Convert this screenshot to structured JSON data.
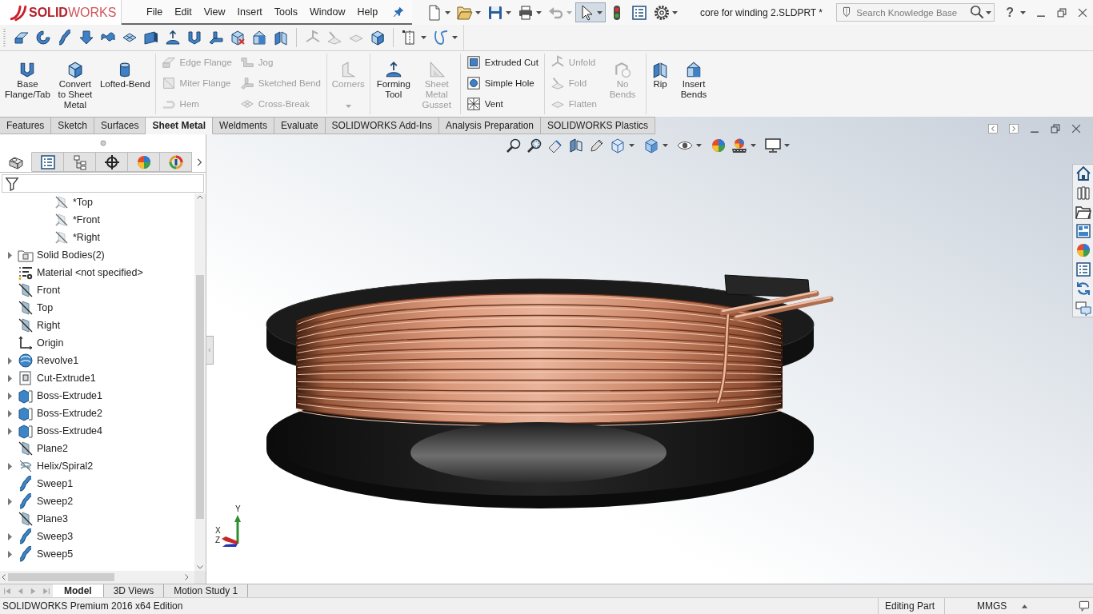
{
  "title_bar": {
    "logo": "**SOLID**WORKS",
    "menu": [
      "File",
      "Edit",
      "View",
      "Insert",
      "Tools",
      "Window",
      "Help"
    ],
    "document_title": "core for winding 2.SLDPRT *",
    "search": {
      "placeholder": "Search Knowledge Base"
    },
    "help": "?"
  },
  "quick_access": [
    {
      "kind": "new",
      "dropdown": true,
      "disabled": false,
      "selected": false
    },
    {
      "kind": "open",
      "dropdown": true,
      "disabled": false,
      "selected": false
    },
    {
      "kind": "save",
      "dropdown": true,
      "disabled": false,
      "selected": false
    },
    {
      "kind": "print",
      "dropdown": true,
      "disabled": false,
      "selected": false
    },
    {
      "kind": "undo",
      "dropdown": true,
      "disabled": true,
      "selected": false
    },
    {
      "kind": "select",
      "dropdown": true,
      "disabled": false,
      "selected": true
    },
    {
      "kind": "rebuild",
      "dropdown": false,
      "disabled": false,
      "selected": false
    },
    {
      "kind": "properties",
      "dropdown": false,
      "disabled": false,
      "selected": false
    },
    {
      "kind": "options",
      "dropdown": true,
      "disabled": false,
      "selected": false
    }
  ],
  "toolbar": [
    {
      "kind": "bentsheet",
      "disabled": false,
      "dropdown": false
    },
    {
      "kind": "ring",
      "disabled": false,
      "dropdown": false
    },
    {
      "kind": "stube",
      "disabled": false,
      "dropdown": false
    },
    {
      "kind": "downarrow",
      "disabled": false,
      "dropdown": false
    },
    {
      "kind": "wave",
      "disabled": false,
      "dropdown": false
    },
    {
      "kind": "crossed",
      "disabled": false,
      "dropdown": false
    },
    {
      "kind": "plate",
      "disabled": false,
      "dropdown": false
    },
    {
      "kind": "dome",
      "disabled": false,
      "dropdown": false
    },
    {
      "kind": "ubracket",
      "disabled": false,
      "dropdown": false
    },
    {
      "kind": "bend",
      "disabled": false,
      "dropdown": false
    },
    {
      "kind": "boxcross",
      "disabled": false,
      "dropdown": false
    },
    {
      "kind": "insertbox",
      "disabled": false,
      "dropdown": false
    },
    {
      "kind": "rip",
      "disabled": false,
      "dropdown": false
    },
    {
      "kind": "separator"
    },
    {
      "kind": "unfold",
      "disabled": true,
      "dropdown": false
    },
    {
      "kind": "fold",
      "disabled": true,
      "dropdown": false
    },
    {
      "kind": "flat",
      "disabled": true,
      "dropdown": false
    },
    {
      "kind": "cube",
      "disabled": false,
      "dropdown": false
    },
    {
      "kind": "separator"
    },
    {
      "kind": "splitline",
      "disabled": false,
      "dropdown": true
    },
    {
      "kind": "spline",
      "disabled": false,
      "dropdown": true
    }
  ],
  "ribbon": {
    "groups": [
      {
        "items": [
          {
            "label": "Base Flange/Tab",
            "kind": "ubracket",
            "disabled": false,
            "dropdown": false
          },
          {
            "label": "Convert to Sheet Metal",
            "kind": "cube",
            "disabled": false,
            "dropdown": false
          },
          {
            "label": "Lofted-Bend",
            "kind": "cylinder",
            "disabled": false,
            "dropdown": false
          }
        ]
      },
      {
        "items": [
          {
            "stack": [
              {
                "label": "Edge Flange",
                "kind": "bentsheet",
                "disabled": true
              },
              {
                "label": "Miter Flange",
                "kind": "miter",
                "disabled": true
              },
              {
                "label": "Hem",
                "kind": "hem",
                "disabled": true
              }
            ]
          },
          {
            "stack": [
              {
                "label": "Jog",
                "kind": "step",
                "disabled": true
              },
              {
                "label": "Sketched Bend",
                "kind": "bend",
                "disabled": true
              },
              {
                "label": "Cross-Break",
                "kind": "crossed",
                "disabled": true
              }
            ]
          }
        ]
      },
      {
        "items": [
          {
            "label": "Corners",
            "kind": "corner",
            "disabled": true,
            "dropdown": true
          }
        ]
      },
      {
        "items": [
          {
            "label": "Forming Tool",
            "kind": "dome",
            "disabled": false,
            "dropdown": false
          },
          {
            "label": "Sheet Metal Gusset",
            "kind": "gusset",
            "disabled": true,
            "dropdown": false
          }
        ]
      },
      {
        "items": [
          {
            "stack": [
              {
                "label": "Extruded Cut",
                "kind": "squarecut",
                "disabled": false
              },
              {
                "label": "Simple Hole",
                "kind": "hole",
                "disabled": false
              },
              {
                "label": "Vent",
                "kind": "vent",
                "disabled": false
              }
            ]
          }
        ]
      },
      {
        "items": [
          {
            "stack": [
              {
                "label": "Unfold",
                "kind": "unfold",
                "disabled": true
              },
              {
                "label": "Fold",
                "kind": "fold",
                "disabled": true
              },
              {
                "label": "Flatten",
                "kind": "flat",
                "disabled": true
              }
            ]
          },
          {
            "label": "No Bends",
            "kind": "nobends",
            "disabled": true,
            "dropdown": false
          }
        ]
      },
      {
        "items": [
          {
            "label": "Rip",
            "kind": "rip",
            "disabled": false,
            "dropdown": false
          },
          {
            "label": "Insert Bends",
            "kind": "insertbox",
            "disabled": false,
            "dropdown": false
          }
        ]
      }
    ]
  },
  "command_tabs": [
    {
      "label": "Features",
      "selected": false
    },
    {
      "label": "Sketch",
      "selected": false
    },
    {
      "label": "Surfaces",
      "selected": false
    },
    {
      "label": "Sheet Metal",
      "selected": true
    },
    {
      "label": "Weldments",
      "selected": false
    },
    {
      "label": "Evaluate",
      "selected": false
    },
    {
      "label": "SOLIDWORKS Add-Ins",
      "selected": false
    },
    {
      "label": "Analysis Preparation",
      "selected": false
    },
    {
      "label": "SOLIDWORKS Plastics",
      "selected": false
    }
  ],
  "feature_panel": {
    "tabs": [
      {
        "kind": "features",
        "selected": true
      },
      {
        "kind": "properties",
        "selected": false
      },
      {
        "kind": "configurations",
        "selected": false
      },
      {
        "kind": "dimxpert",
        "selected": false
      },
      {
        "kind": "display",
        "selected": false
      },
      {
        "kind": "plastics",
        "selected": false
      }
    ],
    "tree": {
      "children_of_item_above": [
        {
          "label": "*Top",
          "kind": "sketchplane"
        },
        {
          "label": "*Front",
          "kind": "sketchplane"
        },
        {
          "label": "*Right",
          "kind": "sketchplane"
        }
      ],
      "items": [
        {
          "label": "Solid Bodies(2)",
          "kind": "bodies",
          "expandable": true
        },
        {
          "label": "Material <not specified>",
          "kind": "material",
          "expandable": false
        },
        {
          "label": "Front",
          "kind": "plane",
          "expandable": false
        },
        {
          "label": "Top",
          "kind": "plane",
          "expandable": false
        },
        {
          "label": "Right",
          "kind": "plane",
          "expandable": false
        },
        {
          "label": "Origin",
          "kind": "origin",
          "expandable": false
        },
        {
          "label": "Revolve1",
          "kind": "revolve",
          "expandable": true
        },
        {
          "label": "Cut-Extrude1",
          "kind": "cut",
          "expandable": true
        },
        {
          "label": "Boss-Extrude1",
          "kind": "boss",
          "expandable": true
        },
        {
          "label": "Boss-Extrude2",
          "kind": "boss",
          "expandable": true
        },
        {
          "label": "Boss-Extrude4",
          "kind": "boss",
          "expandable": true
        },
        {
          "label": "Plane2",
          "kind": "plane",
          "expandable": false
        },
        {
          "label": "Helix/Spiral2",
          "kind": "helix",
          "expandable": true
        },
        {
          "label": "Sweep1",
          "kind": "sweep",
          "expandable": false
        },
        {
          "label": "Sweep2",
          "kind": "sweep",
          "expandable": true
        },
        {
          "label": "Plane3",
          "kind": "plane",
          "expandable": false
        },
        {
          "label": "Sweep3",
          "kind": "sweep",
          "expandable": true
        },
        {
          "label": "Sweep5",
          "kind": "sweep",
          "expandable": true
        }
      ]
    }
  },
  "viewport": {
    "triad_labels": [
      "Y",
      "X",
      "Z"
    ]
  },
  "document_tabs": {
    "navigation": [
      {
        "kind": "first",
        "disabled": true
      },
      {
        "kind": "previous",
        "disabled": true
      },
      {
        "kind": "next",
        "disabled": true
      },
      {
        "kind": "last",
        "disabled": true
      }
    ],
    "tabs": [
      {
        "label": "Model",
        "selected": true
      },
      {
        "label": "3D Views",
        "selected": false
      },
      {
        "label": "Motion Study 1",
        "selected": false
      }
    ]
  },
  "status_bar": {
    "product": "SOLIDWORKS Premium 2016 x64 Edition",
    "mode": "Editing Part",
    "units": "MMGS"
  }
}
